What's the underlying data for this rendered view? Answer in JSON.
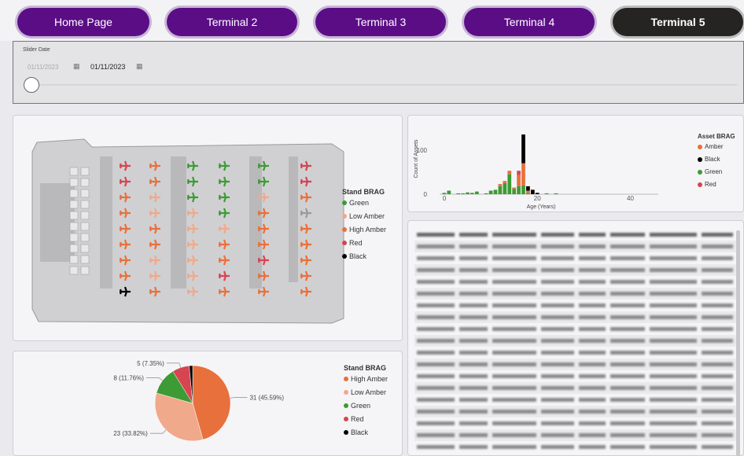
{
  "nav": {
    "tabs": [
      {
        "label": "Home Page"
      },
      {
        "label": "Terminal 2"
      },
      {
        "label": "Terminal 3"
      },
      {
        "label": "Terminal 4"
      },
      {
        "label": "Terminal 5"
      }
    ],
    "active_index": 4,
    "accent": "#5b0d86",
    "active_color": "#252423"
  },
  "slicer": {
    "label": "Slider Date",
    "start": "01/11/2023",
    "end": "01/11/2023",
    "calendar_icon": "calendar-icon"
  },
  "map_legend": {
    "title": "Stand BRAG",
    "items": [
      {
        "label": "Green",
        "color": "#3d9b35"
      },
      {
        "label": "Low Amber",
        "color": "#f0a98a"
      },
      {
        "label": "High Amber",
        "color": "#e8703c"
      },
      {
        "label": "Red",
        "color": "#d64550"
      },
      {
        "label": "Black",
        "color": "#000000"
      }
    ]
  },
  "bar_legend": {
    "title": "Asset BRAG",
    "items": [
      {
        "label": "Amber",
        "color": "#e8703c"
      },
      {
        "label": "Black",
        "color": "#000000"
      },
      {
        "label": "Green",
        "color": "#3d9b35"
      },
      {
        "label": "Red",
        "color": "#d64550"
      }
    ]
  },
  "pie_legend": {
    "title": "Stand BRAG",
    "items": [
      {
        "label": "High Amber",
        "color": "#e8703c"
      },
      {
        "label": "Low Amber",
        "color": "#f0a98a"
      },
      {
        "label": "Green",
        "color": "#3d9b35"
      },
      {
        "label": "Red",
        "color": "#d64550"
      },
      {
        "label": "Black",
        "color": "#000000"
      }
    ]
  },
  "chart_data": [
    {
      "type": "bar",
      "xlabel": "Age (Years)",
      "ylabel": "Count of Assets",
      "xlim": [
        -1,
        46
      ],
      "ylim": [
        0,
        160
      ],
      "xticks": [
        0,
        20,
        40
      ],
      "yticks": [
        0,
        100
      ],
      "stacked": true,
      "bars": [
        {
          "x": 0,
          "Green": 3,
          "Amber": 0,
          "Black": 0,
          "Red": 0
        },
        {
          "x": 1,
          "Green": 8,
          "Amber": 0,
          "Black": 0,
          "Red": 0
        },
        {
          "x": 3,
          "Green": 2,
          "Amber": 0,
          "Black": 0,
          "Red": 0
        },
        {
          "x": 4,
          "Green": 2,
          "Amber": 0,
          "Black": 0,
          "Red": 0
        },
        {
          "x": 5,
          "Green": 4,
          "Amber": 0,
          "Black": 0,
          "Red": 0
        },
        {
          "x": 6,
          "Green": 3,
          "Amber": 0,
          "Black": 0,
          "Red": 0
        },
        {
          "x": 7,
          "Green": 6,
          "Amber": 0,
          "Black": 0,
          "Red": 0
        },
        {
          "x": 9,
          "Green": 2,
          "Amber": 0,
          "Black": 0,
          "Red": 0
        },
        {
          "x": 10,
          "Green": 8,
          "Amber": 0,
          "Black": 0,
          "Red": 0
        },
        {
          "x": 11,
          "Green": 10,
          "Amber": 0,
          "Black": 0,
          "Red": 0
        },
        {
          "x": 12,
          "Green": 18,
          "Amber": 5,
          "Black": 0,
          "Red": 0
        },
        {
          "x": 13,
          "Green": 25,
          "Amber": 5,
          "Black": 0,
          "Red": 0
        },
        {
          "x": 14,
          "Green": 45,
          "Amber": 8,
          "Black": 0,
          "Red": 0
        },
        {
          "x": 15,
          "Green": 12,
          "Amber": 3,
          "Black": 0,
          "Red": 0
        },
        {
          "x": 16,
          "Green": 18,
          "Amber": 25,
          "Black": 0,
          "Red": 10
        },
        {
          "x": 17,
          "Green": 20,
          "Amber": 50,
          "Black": 65,
          "Red": 0
        },
        {
          "x": 18,
          "Green": 3,
          "Amber": 5,
          "Black": 10,
          "Red": 0
        },
        {
          "x": 19,
          "Green": 0,
          "Amber": 0,
          "Black": 10,
          "Red": 0
        },
        {
          "x": 20,
          "Green": 0,
          "Amber": 0,
          "Black": 3,
          "Red": 0
        },
        {
          "x": 22,
          "Green": 2,
          "Amber": 0,
          "Black": 0,
          "Red": 0
        },
        {
          "x": 24,
          "Green": 2,
          "Amber": 0,
          "Black": 0,
          "Red": 0
        }
      ]
    },
    {
      "type": "pie",
      "slices": [
        {
          "name": "High Amber",
          "value": 31,
          "label": "31 (45.59%)",
          "color": "#e8703c"
        },
        {
          "name": "Low Amber",
          "value": 23,
          "label": "23 (33.82%)",
          "color": "#f0a98a"
        },
        {
          "name": "Green",
          "value": 8,
          "label": "8 (11.76%)",
          "color": "#3d9b35"
        },
        {
          "name": "Red",
          "value": 5,
          "label": "5 (7.35%)",
          "color": "#d64550"
        },
        {
          "name": "Black",
          "value": 1,
          "label": "",
          "color": "#000000"
        }
      ]
    }
  ],
  "map": {
    "plane_icon": "airplane-icon",
    "stand_colors": {
      "green": "#3d9b35",
      "low_amber": "#f0a98a",
      "high_amber": "#e8703c",
      "red": "#d64550",
      "black": "#000000",
      "gray": "#9a9a9a"
    }
  }
}
